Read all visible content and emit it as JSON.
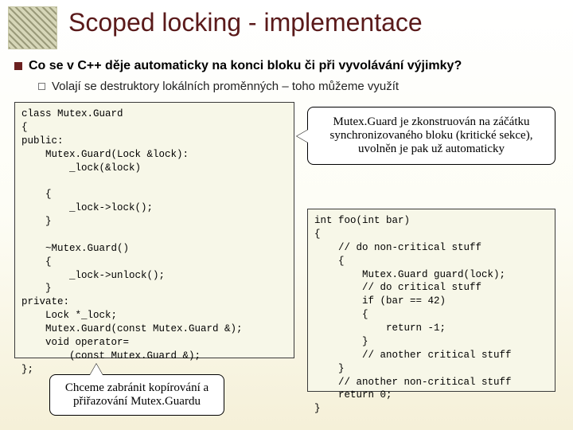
{
  "title": "Scoped locking - implementace",
  "bullets": {
    "b1": "Co se v C++ děje automaticky na konci bloku či při vyvolávání výjimky?",
    "b2": "Volají se destruktory lokálních proměnných – toho můžeme využít"
  },
  "code1": "class Mutex.Guard\n{\npublic:\n    Mutex.Guard(Lock &lock):\n        _lock(&lock)\n\n    {\n        _lock->lock();\n    }\n\n    ~Mutex.Guard()\n    {\n        _lock->unlock();\n    }\nprivate:\n    Lock *_lock;\n    Mutex.Guard(const Mutex.Guard &);\n    void operator=\n        (const Mutex.Guard &);\n};",
  "code2": "int foo(int bar)\n{\n    // do non-critical stuff\n    {\n        Mutex.Guard guard(lock);\n        // do critical stuff\n        if (bar == 42)\n        {\n            return -1;\n        }\n        // another critical stuff\n    }\n    // another non-critical stuff\n    return 0;\n}",
  "callouts": {
    "c1": "Mutex.Guard je zkonstruován na záčátku synchronizovaného bloku (kritické sekce), uvolněn je pak už automaticky",
    "c2": "Chceme zabránit kopírování a přiřazování Mutex.Guardu"
  }
}
